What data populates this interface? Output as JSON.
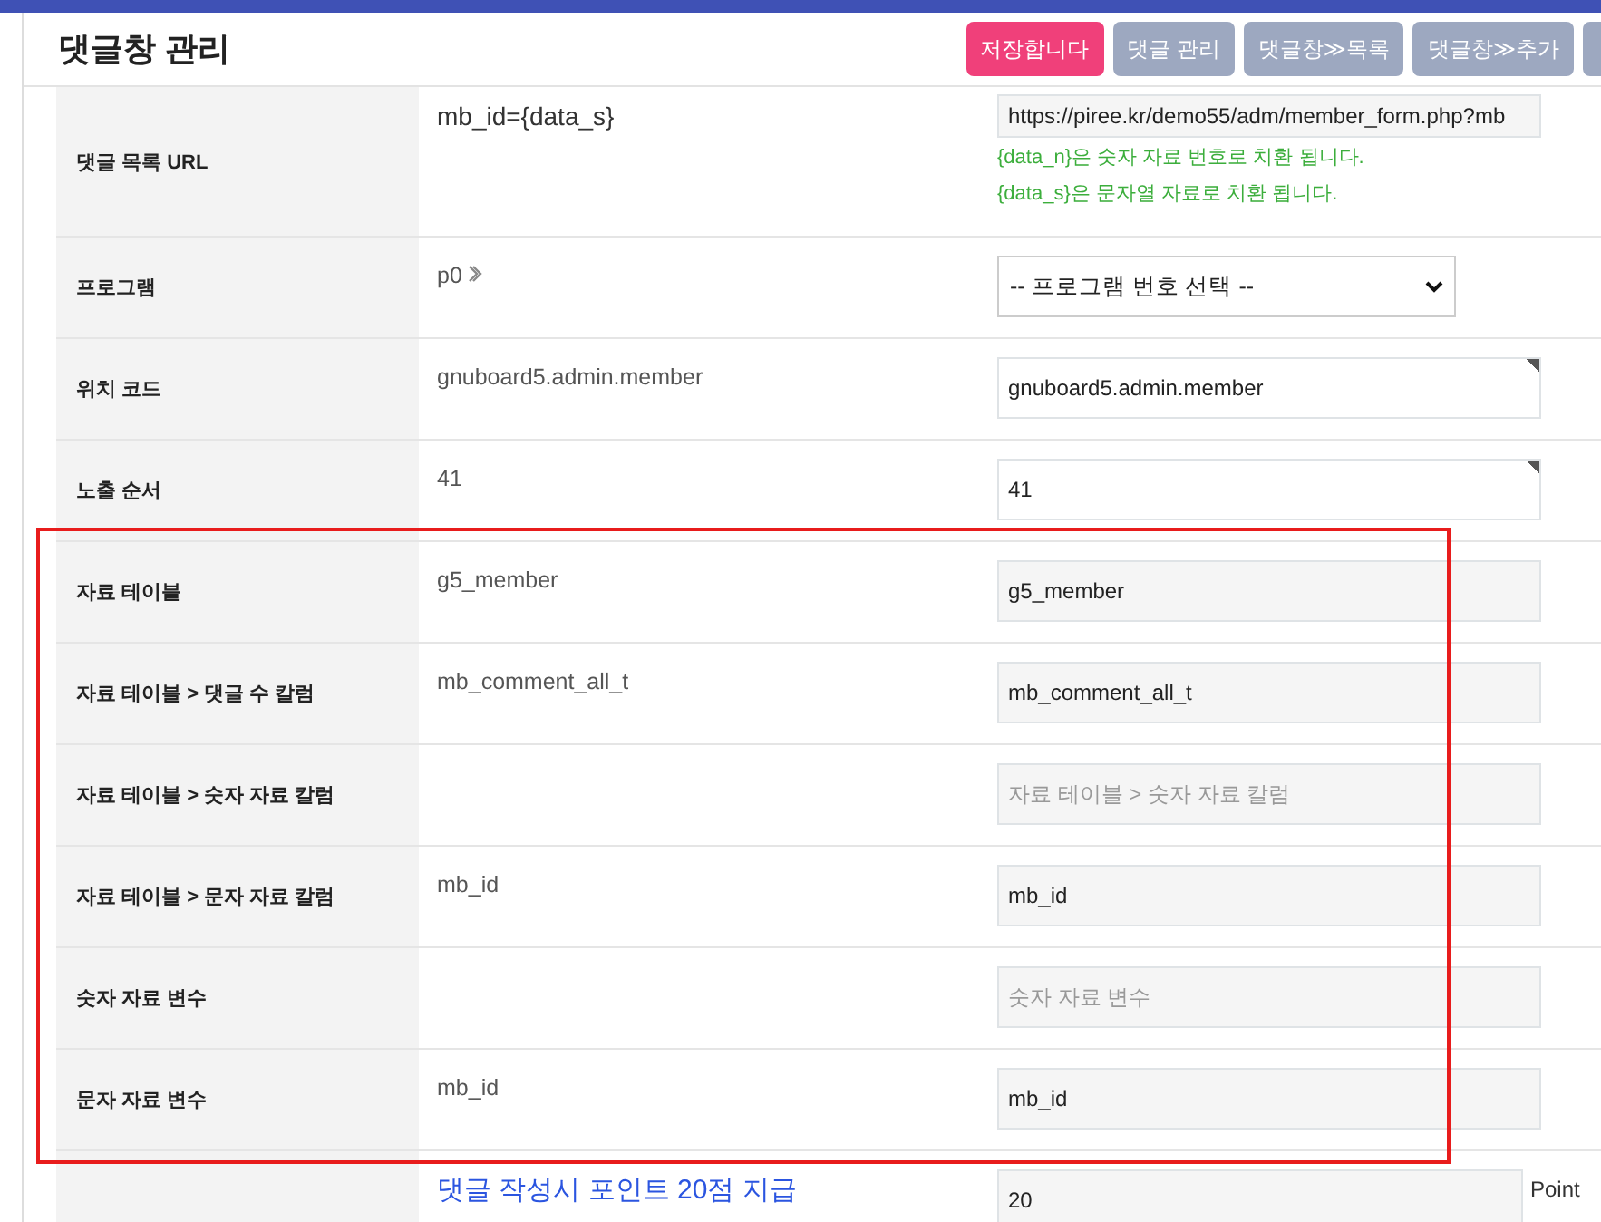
{
  "header": {
    "title": "댓글창 관리",
    "buttons": [
      {
        "label": "저장합니다",
        "kind": "primary"
      },
      {
        "label": "댓글 관리",
        "kind": "secondary"
      },
      {
        "label": "댓글창≫목록",
        "kind": "secondary"
      },
      {
        "label": "댓글창≫추가",
        "kind": "secondary"
      },
      {
        "kind": "cut"
      }
    ]
  },
  "rows": [
    {
      "label": "댓글 목록 URL",
      "value": "mb_id={data_s}",
      "kind": "url",
      "field": {
        "kind": "readonly",
        "value": "https://piree.kr/demo55/adm/member_form.php?mb",
        "required": false
      },
      "notes": [
        "{data_n}은 숫자 자료 번호로 치환 됩니다.",
        "{data_s}은 문자열 자료로 치환 됩니다."
      ]
    },
    {
      "label": "프로그램",
      "value": "p0",
      "kind": "chevron",
      "field": {
        "kind": "select",
        "value": "-- 프로그램 번호 선택 --"
      }
    },
    {
      "label": "위치 코드",
      "value": "gnuboard5.admin.member",
      "kind": "plain",
      "field": {
        "kind": "input",
        "value": "gnuboard5.admin.member",
        "required": true
      }
    },
    {
      "label": "노출 순서",
      "value": "41",
      "kind": "plain",
      "field": {
        "kind": "input",
        "value": "41",
        "required": true
      }
    }
  ],
  "highlight_box": {
    "rows": [
      {
        "label": "자료 테이블",
        "value": "g5_member",
        "kind": "plain",
        "field": {
          "kind": "readonly",
          "value": "g5_member",
          "required": false
        }
      },
      {
        "label": "자료 테이블 > 댓글 수 칼럼",
        "value": "mb_comment_all_t",
        "kind": "plain",
        "field": {
          "kind": "readonly",
          "value": "mb_comment_all_t",
          "required": false
        }
      },
      {
        "label": "자료 테이블 > 숫자 자료 칼럼",
        "kind": "plain",
        "field": {
          "kind": "readonly",
          "placeholder": "자료 테이블 > 숫자 자료 칼럼",
          "required": false
        }
      },
      {
        "label": "자료 테이블 > 문자 자료 칼럼",
        "value": "mb_id",
        "kind": "plain",
        "field": {
          "kind": "readonly",
          "value": "mb_id",
          "required": false
        }
      },
      {
        "label": "숫자 자료 변수",
        "kind": "plain",
        "field": {
          "kind": "readonly",
          "placeholder": "숫자 자료 변수",
          "required": false
        }
      },
      {
        "label": "문자 자료 변수",
        "value": "mb_id",
        "kind": "plain",
        "field": {
          "kind": "readonly",
          "value": "mb_id",
          "required": false
        }
      }
    ]
  },
  "footer_rows": [
    {
      "value": "댓글 작성시 포인트 20점 지급",
      "kind": "link",
      "field": {
        "kind": "readonly",
        "value": "20",
        "required": false,
        "suffix": "Point"
      }
    }
  ]
}
